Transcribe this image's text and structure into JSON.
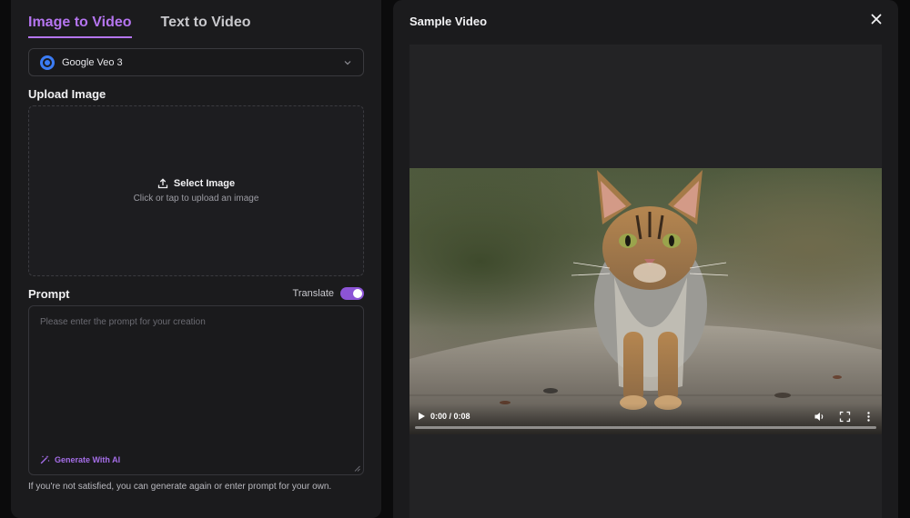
{
  "tabs": [
    {
      "label": "Image to Video",
      "active": true
    },
    {
      "label": "Text to Video",
      "active": false
    }
  ],
  "model": {
    "label": "Google Veo 3",
    "icon": "google-veo-logo",
    "color": "#3b7cf5"
  },
  "upload": {
    "label": "Upload Image",
    "button_label": "Select Image",
    "hint": "Click or tap to upload an image"
  },
  "prompt": {
    "label": "Prompt",
    "translate_label": "Translate",
    "translate_enabled": true,
    "placeholder": "Please enter the prompt for your creation",
    "value": "",
    "generate_label": "Generate With AI"
  },
  "bottom_hint": "If you're not satisfied, you can generate again or enter prompt for your own.",
  "sample": {
    "title": "Sample Video",
    "time": "0:00 / 0:08",
    "progress": 0
  },
  "colors": {
    "accent": "#b575f0",
    "toggle": "#8c54d6",
    "panel": "#1b1b1d",
    "background": "#0b0b0c"
  }
}
